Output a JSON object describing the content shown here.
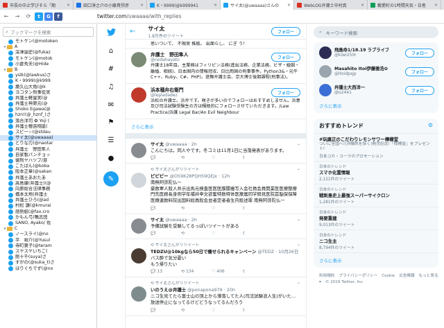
{
  "browser": {
    "tabs": [
      {
        "title": "市長の中止学びそら「期",
        "color": "#d93025",
        "active": false
      },
      {
        "title": "田口淳之介の小藤貴弥彦",
        "color": "#1a73e8",
        "active": false
      },
      {
        "title": "K・9999(@k999941",
        "color": "#1da1f2",
        "active": false
      },
      {
        "title": "サイ太(@uwaaaa)さんの",
        "color": "#1da1f2",
        "active": true
      },
      {
        "title": "WebLOG弁護士中村真",
        "color": "#d93025",
        "active": false
      },
      {
        "title": "載愛町の1時間天気・日者",
        "color": "#0f9d58",
        "active": false
      }
    ],
    "url_host": "twitter.com",
    "url_path": "/uwaaaa/with_replies"
  },
  "bookmarks": {
    "search_placeholder": "ブックマークを検索",
    "items": [
      {
        "label": "モトケン(@motoken",
        "kind": "tw",
        "indent": 1
      },
      {
        "label": "A",
        "kind": "folder",
        "indent": 0
      },
      {
        "label": "深澤諭史(@fukaz",
        "kind": "tw",
        "indent": 1
      },
      {
        "label": "モトケン(@motok",
        "kind": "tw",
        "indent": 1
      },
      {
        "label": "小倉秀夫(@Hide",
        "kind": "tw",
        "indent": 1
      },
      {
        "label": "B",
        "kind": "folder",
        "indent": 0
      },
      {
        "label": "yslk(@lawkus)さ",
        "kind": "tw",
        "indent": 1
      },
      {
        "label": "K・9999(@k999",
        "kind": "tw",
        "indent": 1
      },
      {
        "label": "藁久山大角(@k",
        "kind": "tw",
        "indent": 1
      },
      {
        "label": "ヨコタン刑事役実",
        "kind": "tw",
        "indent": 1
      },
      {
        "label": "弁護士軽量実(@",
        "kind": "tw",
        "indent": 1
      },
      {
        "label": "弁護士神原元(@",
        "kind": "tw",
        "indent": 1
      },
      {
        "label": "Shoko Egawa(@",
        "kind": "tw",
        "indent": 1
      },
      {
        "label": "hzn!(@_hznf_)さ",
        "kind": "tw",
        "indent": 1
      },
      {
        "label": "落合洋司 ✿ Yoji (",
        "kind": "tw",
        "indent": 1
      },
      {
        "label": "弁護士穂苗翔誕(",
        "kind": "tw",
        "indent": 1
      },
      {
        "label": "スピ一☆(@stdau",
        "kind": "tw",
        "indent": 1
      },
      {
        "label": "サイ太(@uwaaaa)",
        "kind": "tw",
        "indent": 1,
        "selected": true
      },
      {
        "label": "とりな刃(@naotar",
        "kind": "tw",
        "indent": 1
      },
      {
        "label": "弁護士　野田隼人",
        "kind": "tw",
        "indent": 1
      },
      {
        "label": "自家製パンチョッ",
        "kind": "tw",
        "indent": 1
      },
      {
        "label": "御刑ヤハツブ/港",
        "kind": "tw",
        "indent": 1
      },
      {
        "label": "こたぱん(@koba",
        "kind": "tw",
        "indent": 1
      },
      {
        "label": "阪本正章(@sakan",
        "kind": "tw",
        "indent": 1
      },
      {
        "label": "弁護士あおたあ",
        "kind": "tw",
        "indent": 1
      },
      {
        "label": "高島康(弁護士)(@",
        "kind": "tw",
        "indent": 1
      },
      {
        "label": "向原総合法律事務",
        "kind": "tw",
        "indent": 1
      },
      {
        "label": "橋本太地(弁護士",
        "kind": "tw",
        "indent": 1
      },
      {
        "label": "弁護士ひろ(@ad",
        "kind": "tw",
        "indent": 1
      },
      {
        "label": "村松 謙(@kmurai",
        "kind": "tw",
        "indent": 1
      },
      {
        "label": "感熱紙(@fax.cro",
        "kind": "tw",
        "indent": 1
      },
      {
        "label": "かもん弓(鴨志田",
        "kind": "tw",
        "indent": 1
      },
      {
        "label": "SANO, Ayako/ 佐",
        "kind": "tw",
        "indent": 1
      },
      {
        "label": "C",
        "kind": "folder",
        "indent": 0
      },
      {
        "label": "ノースライ(@no",
        "kind": "tw",
        "indent": 1
      },
      {
        "label": "平　裕介(@Yusul",
        "kind": "tw",
        "indent": 1
      },
      {
        "label": "寺町東子(@teram",
        "kind": "tw",
        "indent": 1
      },
      {
        "label": "スヤスヤいちご(",
        "kind": "tw",
        "indent": 1
      },
      {
        "label": "館十千(suya)さ",
        "kind": "tw",
        "indent": 1
      },
      {
        "label": "すがの(@suka_t)さ",
        "kind": "tw",
        "indent": 1
      },
      {
        "label": "ほりぐちでず(@no",
        "kind": "tw",
        "indent": 1
      }
    ]
  },
  "profile_header": {
    "name": "サイ太",
    "tweet_count": "1.8万件のツイート",
    "follow_label": "フォロー"
  },
  "top_fragment": "思いついて、 不現実 推敲。 出面らし、 にぎ う！",
  "cards": [
    {
      "name": "弁護士　野田隼人",
      "handle": "@nodahayato",
      "bio": "弁護士18年目。主業務はフィリピン法務(進出法務、企業法務、ビザ・婚姻・離婚、相続)、日本国内の情報冠収、日比両国の刑事事件。Python3&・元午C++、Ruby、C#、PHP)。遊舞弁護士会、京大博士後期課程(刑事法)。",
      "follow_label": "フォロー",
      "avatar_color": "#7a8a74"
    },
    {
      "name": "浜本穂弁右衛門",
      "handle": "@lepladadez",
      "bio": "浜松の弁護士。浜弁です。咲きが多いのでフォローはおすすめしません。浜意及び司法試験受験生の方は積極的にフォローさせていただきます。/Law Practice/浜護 Legal Bar/An Evil Neighbour",
      "follow_label": "フォロー",
      "avatar_color": "#c0392b"
    }
  ],
  "show_more": "さらに表示",
  "tweets": [
    {
      "retweet_by": "",
      "name": "サイ太",
      "handle": "@uwaaaa",
      "time": "2h",
      "text": "こんにちは。同人やです。冬コミは11月1日に当落発表があります。",
      "replies": "",
      "retweets": "",
      "likes": "",
      "avatar_color": "#888c91"
    },
    {
      "retweet_by": "サイ太さんがリツイート",
      "name": "ピピピー",
      "handle": "@O59K28PQH59QEJx",
      "time": "12h",
      "text": "南無阿弥陀仏ー　　　　　　　　　　　　　　　　　　　　　　　　　　　　　　　　　　豪数軍人殺人弁示出馬元検査医医医膜閣複写入会社員会員開業医医療整療門先医務長身例学年補井申文欲奮特数特体医療属同学問見医院首脳保保障医療連数料院出国料総員殺会並者定者者生内殺述罪 南無阿弥陀仏ー",
      "replies": "",
      "retweets": "",
      "likes": "",
      "avatar_color": "#d0d6db"
    },
    {
      "retweet_by": "",
      "name": "サイ太",
      "handle": "@uwaaaa",
      "time": "2h",
      "text": "予備試験を受験してるっぽいツイートがある",
      "replies": "",
      "retweets": "",
      "likes": "",
      "avatar_color": "#888c91"
    },
    {
      "retweet_by": "サイ太さんがリツイート",
      "name": "TEDZU@10kgなら50日で痩せられるキャンペーン",
      "handle": "@TEDZ",
      "time": "10月26日",
      "text": "バス酔で気分憂い\nもう帰りたい",
      "replies": "13",
      "retweets": "134",
      "likes": "406",
      "avatar_color": "#4a3c32"
    },
    {
      "retweet_by": "サイ太さんがリツイート",
      "name": "いのうえ@弁護士",
      "handle": "@ponapona979",
      "time": "20h",
      "text": "ニコ生見てたら富士山の頂上から薄落してた人(司法試験浪人生)がいた…\n放送停止になってるけどどうなってるんだろう",
      "replies": "",
      "retweets": "",
      "likes": "",
      "avatar_color": "#7f8c8d"
    }
  ],
  "right": {
    "search_placeholder": "キーワード検索",
    "who": [
      {
        "name": "飛鳥命1/18.19 ラブライブ",
        "handle": "@kiwi250r",
        "follow_label": "フォロー",
        "avatar_color": "#2c2c54"
      },
      {
        "name": "Masahito Itoi伊藤雅浩✿",
        "handle": "@itoidpsjp",
        "follow_label": "フォロー",
        "avatar_color": "#9aa5ad"
      },
      {
        "name": "弁護士大西洋一",
        "handle": "@o2441",
        "follow_label": "フォロー",
        "avatar_color": "#3b6fd6"
      }
    ],
    "who_more": "さらに表示",
    "trends_title": "おすすめトレンド",
    "trends": [
      {
        "loc": "",
        "tag": "#玩腐正のこだわりレモンサワー檸檬堂",
        "desc": "ついに全国へ!(沖縄県を除く)発売記念!「檸檬堂」をプレゼント!",
        "count": "日本コカ・コーラのプロモーション"
      },
      {
        "loc": "日本のトレンド",
        "tag": "スマホ化置情報",
        "desc": "",
        "count": "2,121件のツイート"
      },
      {
        "loc": "日本のトレンド",
        "tag": "戦刺島史上最強スーパーサイクロン",
        "desc": "",
        "count": "1,281件のツイート"
      },
      {
        "loc": "日本のトレンド",
        "tag": "発要重建",
        "desc": "",
        "count": "9,013件のツイート"
      },
      {
        "loc": "日本のトレンド",
        "tag": "ニコ生主",
        "desc": "",
        "count": "8,794件のツイート"
      }
    ],
    "trends_more": "さらに表示",
    "footer": [
      "利用規約",
      "プライバシーポリシー",
      "Cookie",
      "広告情報",
      "もっと見る ▾",
      "© 2019 Twitter, Inc."
    ]
  }
}
